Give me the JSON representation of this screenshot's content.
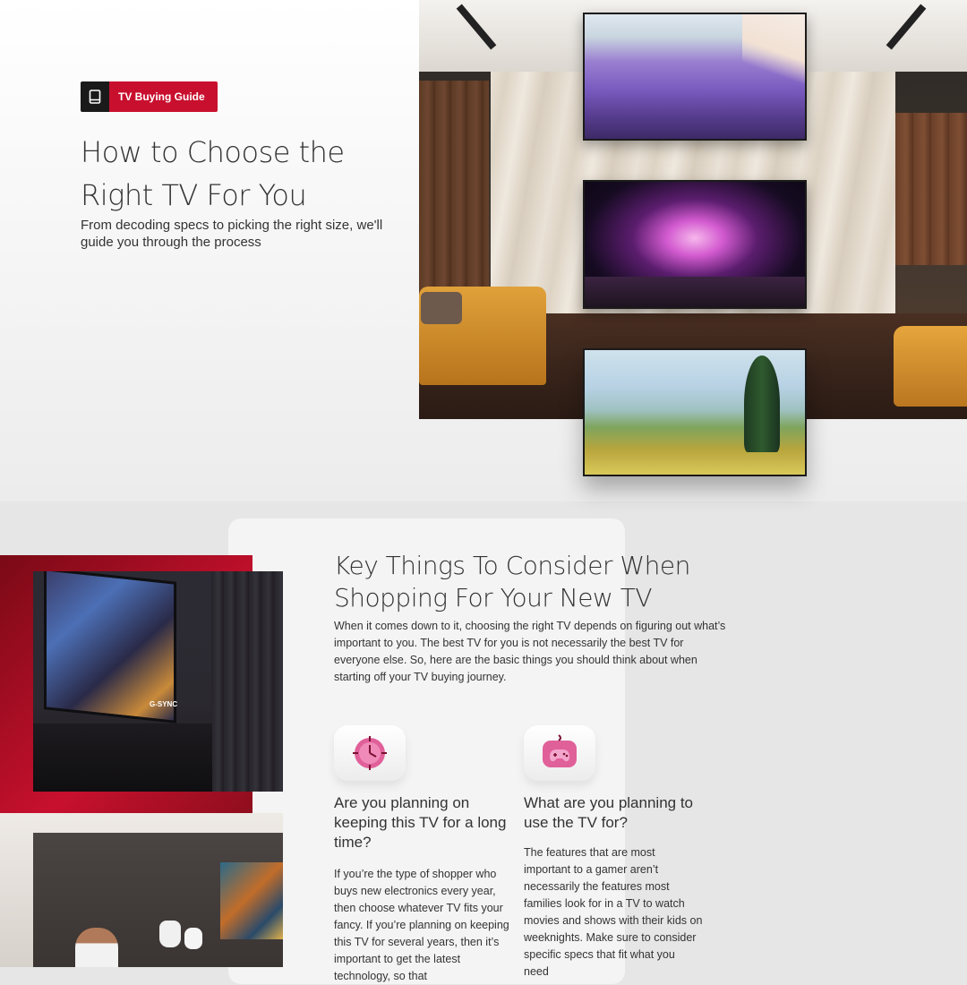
{
  "hero": {
    "badge_icon": "book-icon",
    "badge_label": "TV Buying Guide",
    "title": "How to Choose the Right TV For You",
    "subtitle": "From decoding specs to picking the right size, we'll guide you through the process"
  },
  "key_section": {
    "title": "Key Things To Consider When Shopping For Your New TV",
    "description": "When it comes down to it, choosing the right TV depends on figuring out what’s important to you. The best TV for you is not necessarily the best TV for everyone else. So, here are the basic things you should think about when starting off your TV buying journey.",
    "gaming_photo_text": "G-SYNC",
    "features": [
      {
        "icon": "clock-icon",
        "title": "Are you planning on keeping this TV for a long time?",
        "body": "If you’re the type of shopper who buys new electronics every year, then choose whatever TV fits your fancy. If you’re planning on keeping this TV for several years, then it’s important to get the latest technology, so that"
      },
      {
        "icon": "gamepad-icon",
        "title": "What are you planning to use the TV for?",
        "body": "The features that are most important to a gamer aren’t necessarily the features most families look for in a TV to watch movies and shows with their kids on weeknights. Make sure to consider specific specs that fit what you need"
      }
    ]
  },
  "colors": {
    "brand_red": "#c8102e",
    "icon_pink": "#e0609a"
  }
}
